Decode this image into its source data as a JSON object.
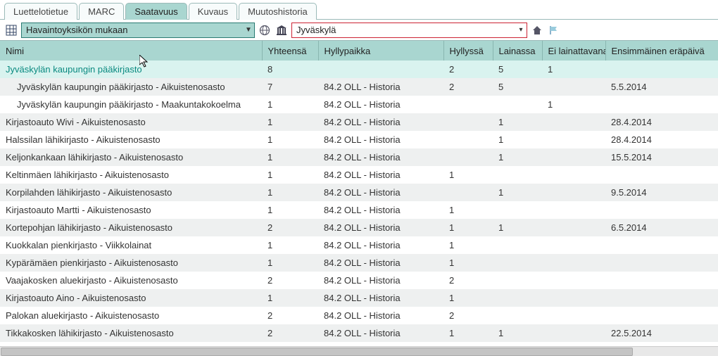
{
  "tabs": [
    "Luettelotietue",
    "MARC",
    "Saatavuus",
    "Kuvaus",
    "Muutoshistoria"
  ],
  "activeTabIndex": 2,
  "toolbar": {
    "grouping": "Havaintoyksikön mukaan",
    "location": "Jyväskylä"
  },
  "columns": [
    "Nimi",
    "Yhteensä",
    "Hyllypaikka",
    "Hyllyssä",
    "Lainassa",
    "Ei lainattavana",
    "Ensimmäinen eräpäivä"
  ],
  "rows": [
    {
      "type": "parent",
      "nimi": "Jyväskylän kaupungin pääkirjasto",
      "yht": "8",
      "hylly": "",
      "hyllyssa": "2",
      "lainassa": "5",
      "eilain": "1",
      "erapv": ""
    },
    {
      "type": "child",
      "nimi": "Jyväskylän kaupungin pääkirjasto - Aikuistenosasto",
      "yht": "7",
      "hylly": "84.2 OLL - Historia",
      "hyllyssa": "2",
      "lainassa": "5",
      "eilain": "",
      "erapv": "5.5.2014"
    },
    {
      "type": "child",
      "nimi": "Jyväskylän kaupungin pääkirjasto - Maakuntakokoelma",
      "yht": "1",
      "hylly": "84.2 OLL - Historia",
      "hyllyssa": "",
      "lainassa": "",
      "eilain": "1",
      "erapv": ""
    },
    {
      "type": "row",
      "nimi": "Kirjastoauto Wivi - Aikuistenosasto",
      "yht": "1",
      "hylly": "84.2 OLL - Historia",
      "hyllyssa": "",
      "lainassa": "1",
      "eilain": "",
      "erapv": "28.4.2014"
    },
    {
      "type": "row",
      "nimi": "Halssilan lähikirjasto - Aikuistenosasto",
      "yht": "1",
      "hylly": "84.2 OLL - Historia",
      "hyllyssa": "",
      "lainassa": "1",
      "eilain": "",
      "erapv": "28.4.2014"
    },
    {
      "type": "row",
      "nimi": "Keljonkankaan lähikirjasto - Aikuistenosasto",
      "yht": "1",
      "hylly": "84.2 OLL - Historia",
      "hyllyssa": "",
      "lainassa": "1",
      "eilain": "",
      "erapv": "15.5.2014"
    },
    {
      "type": "row",
      "nimi": "Keltinmäen lähikirjasto - Aikuistenosasto",
      "yht": "1",
      "hylly": "84.2 OLL - Historia",
      "hyllyssa": "1",
      "lainassa": "",
      "eilain": "",
      "erapv": ""
    },
    {
      "type": "row",
      "nimi": "Korpilahden lähikirjasto - Aikuistenosasto",
      "yht": "1",
      "hylly": "84.2 OLL - Historia",
      "hyllyssa": "",
      "lainassa": "1",
      "eilain": "",
      "erapv": "9.5.2014"
    },
    {
      "type": "row",
      "nimi": "Kirjastoauto Martti - Aikuistenosasto",
      "yht": "1",
      "hylly": "84.2 OLL - Historia",
      "hyllyssa": "1",
      "lainassa": "",
      "eilain": "",
      "erapv": ""
    },
    {
      "type": "row",
      "nimi": "Kortepohjan lähikirjasto - Aikuistenosasto",
      "yht": "2",
      "hylly": "84.2 OLL - Historia",
      "hyllyssa": "1",
      "lainassa": "1",
      "eilain": "",
      "erapv": "6.5.2014"
    },
    {
      "type": "row",
      "nimi": "Kuokkalan pienkirjasto - Viikkolainat",
      "yht": "1",
      "hylly": "84.2 OLL - Historia",
      "hyllyssa": "1",
      "lainassa": "",
      "eilain": "",
      "erapv": ""
    },
    {
      "type": "row",
      "nimi": "Kypärämäen pienkirjasto - Aikuistenosasto",
      "yht": "1",
      "hylly": "84.2 OLL - Historia",
      "hyllyssa": "1",
      "lainassa": "",
      "eilain": "",
      "erapv": ""
    },
    {
      "type": "row",
      "nimi": "Vaajakosken aluekirjasto - Aikuistenosasto",
      "yht": "2",
      "hylly": "84.2 OLL - Historia",
      "hyllyssa": "2",
      "lainassa": "",
      "eilain": "",
      "erapv": ""
    },
    {
      "type": "row",
      "nimi": "Kirjastoauto Aino - Aikuistenosasto",
      "yht": "1",
      "hylly": "84.2 OLL - Historia",
      "hyllyssa": "1",
      "lainassa": "",
      "eilain": "",
      "erapv": ""
    },
    {
      "type": "row",
      "nimi": "Palokan aluekirjasto - Aikuistenosasto",
      "yht": "2",
      "hylly": "84.2 OLL - Historia",
      "hyllyssa": "2",
      "lainassa": "",
      "eilain": "",
      "erapv": ""
    },
    {
      "type": "row",
      "nimi": "Tikkakosken lähikirjasto - Aikuistenosasto",
      "yht": "2",
      "hylly": "84.2 OLL - Historia",
      "hyllyssa": "1",
      "lainassa": "1",
      "eilain": "",
      "erapv": "22.5.2014"
    }
  ]
}
